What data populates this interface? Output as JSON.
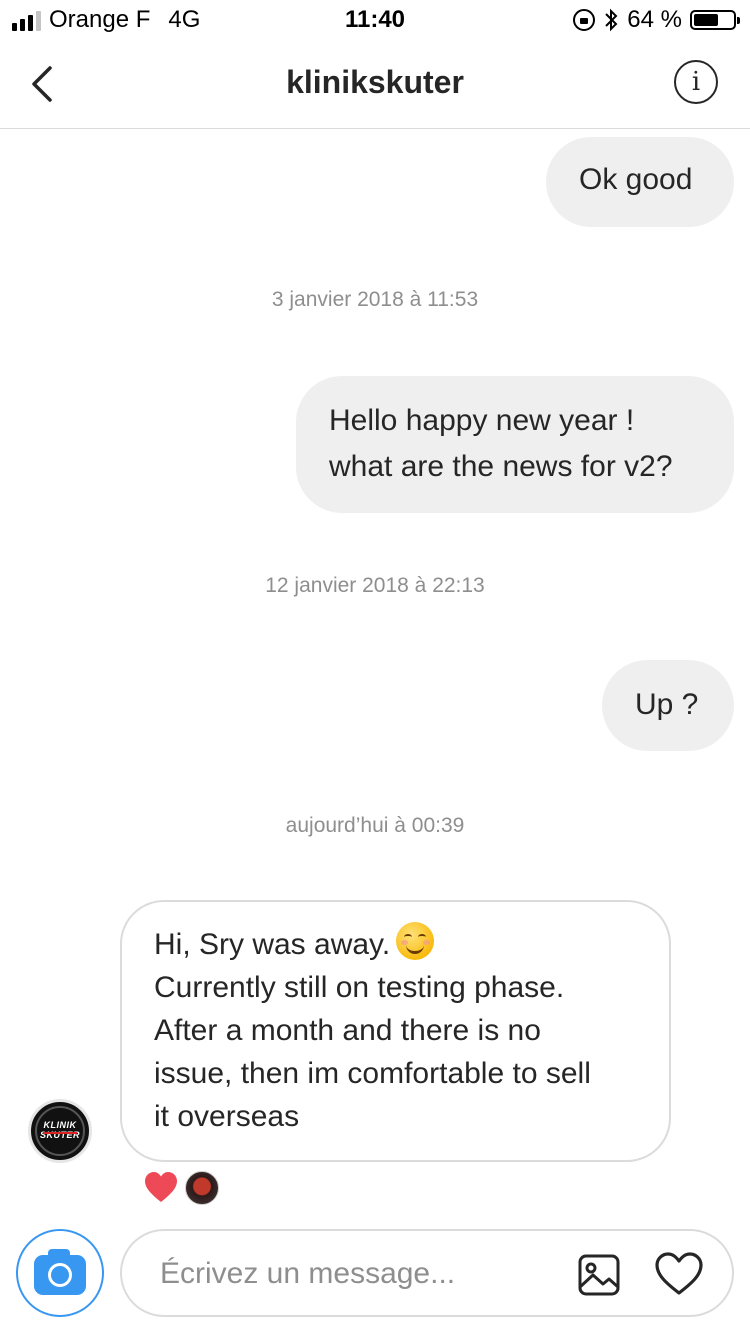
{
  "status_bar": {
    "carrier": "Orange F",
    "network": "4G",
    "time": "11:40",
    "battery_text": "64 %",
    "battery_level": 0.64,
    "signal_bars_filled": 3,
    "signal_bars_total": 4
  },
  "header": {
    "title": "klinikskuter",
    "back_icon": "chevron-left-icon",
    "info_icon": "info-icon",
    "info_glyph": "i"
  },
  "conversation": {
    "messages": [
      {
        "direction": "out",
        "text": "Ok good"
      },
      {
        "direction": "out",
        "lines": [
          "Hello happy new year !",
          "what are the news for v2?"
        ]
      },
      {
        "direction": "out",
        "text": "Up ?"
      },
      {
        "direction": "in",
        "lines": [
          "Hi, Sry was away.",
          "Currently still on testing phase.",
          "After a month and there is no",
          "issue, then im comfortable to sell",
          "it overseas"
        ],
        "emoji": "smiling-face-icon"
      }
    ],
    "timestamps": [
      "3 janvier 2018 à 11:53",
      "12 janvier 2018 à 22:13",
      "aujourd’hui à 00:39"
    ],
    "sender_avatar_text": [
      "KLINIK",
      "SKUTER"
    ],
    "reactions": [
      "heart-icon",
      "reactor-avatar"
    ]
  },
  "composer": {
    "placeholder": "Écrivez un message...",
    "camera_icon": "camera-icon",
    "gallery_icon": "image-icon",
    "like_icon": "heart-icon"
  },
  "colors": {
    "accent": "#3897f0",
    "bubble_out": "#efefef",
    "border": "#dbdbdb",
    "muted_text": "#8e8e8e",
    "reaction_heart": "#ed4956"
  }
}
